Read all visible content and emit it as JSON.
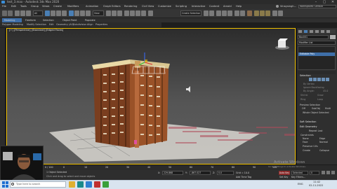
{
  "window": {
    "title": "test_3.max - Autodesk 3ds Max 2020",
    "controls": [
      "–",
      "▢",
      "✕"
    ]
  },
  "menu": [
    "File",
    "Edit",
    "Tools",
    "Group",
    "Views",
    "Create",
    "Modifiers",
    "Animation",
    "Graph Editors",
    "Rendering",
    "Civil View",
    "Customize",
    "Scripting",
    "Interactive",
    "Content",
    "Arnold",
    "Help"
  ],
  "account": {
    "user": "Vinaysingh...",
    "workspace": "Workspaces: Default"
  },
  "toolbar": {
    "filter_dropdown": "All",
    "view_dropdown": "View",
    "selection_set": "Create Selection Se..."
  },
  "ribbon": {
    "tabs": [
      "Modeling",
      "Freeform",
      "Selection",
      "Object Paint",
      "Populate"
    ],
    "sub_items": [
      "Polygon Modeling",
      "Modify Selection",
      "Edit",
      "Geometry (All)",
      "Subdivision",
      "Align",
      "Properties"
    ]
  },
  "viewport": {
    "label": "[+] [Perspective] [Standard] [Edged Faces]"
  },
  "command_panel": {
    "object_name": "Box001",
    "modifier_list": "Modifier List",
    "stack_item": "Editable Poly",
    "rollout_selection": "Selection",
    "by_vertex": "By Vertex",
    "ignore_backfacing": "Ignore Backfacing",
    "by_angle": "By Angle:",
    "angle_value": "45.0",
    "shrink": "Shrink",
    "grow": "Grow",
    "ring": "Ring",
    "loop": "Loop",
    "preview_selection": "Preview Selection",
    "off": "Off",
    "subobj": "SubObj",
    "multi": "Multi",
    "whole_object": "Whole Object Selected",
    "soft_selection": "Soft Selection",
    "edit_geometry": "Edit Geometry",
    "repeat_last": "Repeat Last",
    "constraints": "Constraints",
    "none": "None",
    "edge": "Edge",
    "face": "Face",
    "normal": "Normal",
    "preserve_uvs": "Preserve UVs",
    "create": "Create",
    "collapse": "Collapse"
  },
  "timeline": {
    "frame_label": "0 / 100",
    "ticks": [
      "0",
      "10",
      "20",
      "30",
      "40",
      "50",
      "60",
      "70",
      "80",
      "90",
      "100"
    ]
  },
  "status": {
    "selected": "1 Object Selected",
    "hint": "Click and drag to select and move objects",
    "x_label": "X:",
    "x": "229.868",
    "y_label": "Y:",
    "y": "-867.027",
    "z_label": "Z:",
    "z": "0.0",
    "grid": "Grid = 10.0",
    "add_time_tag": "Add Time Tag",
    "auto_key": "Auto Key",
    "set_key": "Set Key",
    "selected_dd": "Selected",
    "key_filters": "Key Filters...",
    "frame_value": "0"
  },
  "activation": {
    "line1": "Activate Windows",
    "line2": "Go to Settings to activate Windows."
  },
  "taskbar": {
    "search": "Type here to search",
    "time": "11:42",
    "date": "02-11-2022",
    "lang": "ENG"
  },
  "colors": {
    "accent_selection": "#f0c000",
    "ribbon_tab_active": "#3f6fa8",
    "brick": "#8c4a26",
    "roof": "#e9d9a6"
  }
}
